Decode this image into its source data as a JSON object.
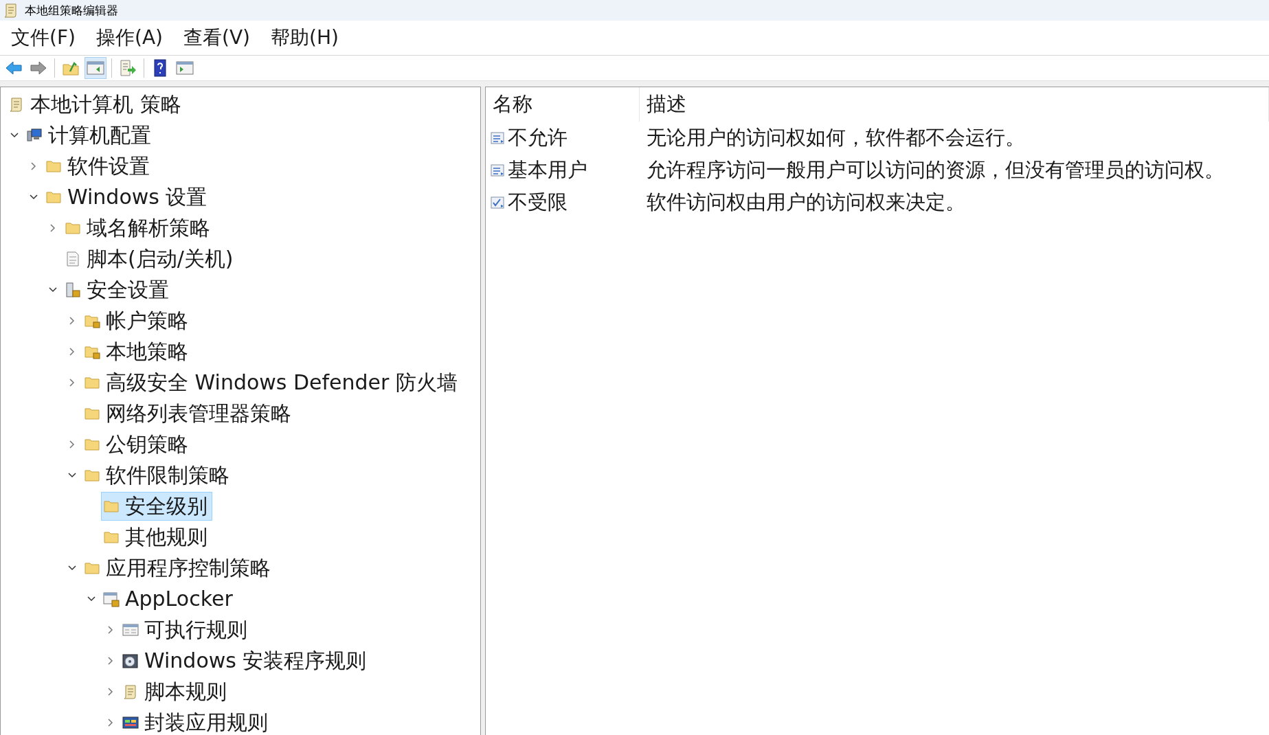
{
  "window": {
    "title": "本地组策略编辑器"
  },
  "menu": [
    "文件(F)",
    "操作(A)",
    "查看(V)",
    "帮助(H)"
  ],
  "toolbar": [
    [
      {
        "kind": "back",
        "pressed": false
      },
      {
        "kind": "forward",
        "pressed": false
      }
    ],
    [
      {
        "kind": "up",
        "pressed": false
      },
      {
        "kind": "tree-toggle",
        "pressed": true
      }
    ],
    [
      {
        "kind": "export",
        "pressed": false
      }
    ],
    [
      {
        "kind": "help",
        "pressed": false
      },
      {
        "kind": "action-pane",
        "pressed": false
      }
    ]
  ],
  "tree": {
    "label": "本地计算机 策略",
    "kind": "scroll",
    "selected": false,
    "children": [
      {
        "label": "计算机配置",
        "kind": "computer",
        "expanded": true,
        "selected": false,
        "children": [
          {
            "label": "软件设置",
            "kind": "folder",
            "expanded": false,
            "selected": false
          },
          {
            "label": "Windows 设置",
            "kind": "folder",
            "expanded": true,
            "selected": false,
            "children": [
              {
                "label": "域名解析策略",
                "kind": "folder",
                "expanded": false,
                "selected": false
              },
              {
                "label": "脚本(启动/关机)",
                "kind": "script",
                "selected": false
              },
              {
                "label": "安全设置",
                "kind": "security",
                "expanded": true,
                "selected": false,
                "children": [
                  {
                    "label": "帐户策略",
                    "kind": "folder-lock",
                    "expanded": false,
                    "selected": false
                  },
                  {
                    "label": "本地策略",
                    "kind": "folder-lock",
                    "expanded": false,
                    "selected": false
                  },
                  {
                    "label": "高级安全 Windows Defender 防火墙",
                    "kind": "folder",
                    "expanded": false,
                    "selected": false
                  },
                  {
                    "label": "网络列表管理器策略",
                    "kind": "folder",
                    "selected": false
                  },
                  {
                    "label": "公钥策略",
                    "kind": "folder",
                    "expanded": false,
                    "selected": false
                  },
                  {
                    "label": "软件限制策略",
                    "kind": "folder",
                    "expanded": true,
                    "selected": false,
                    "children": [
                      {
                        "label": "安全级别",
                        "kind": "folder",
                        "selected": true
                      },
                      {
                        "label": "其他规则",
                        "kind": "folder",
                        "selected": false
                      }
                    ]
                  },
                  {
                    "label": "应用程序控制策略",
                    "kind": "folder",
                    "expanded": true,
                    "selected": false,
                    "children": [
                      {
                        "label": "AppLocker",
                        "kind": "window-lock",
                        "expanded": true,
                        "selected": false,
                        "children": [
                          {
                            "label": "可执行规则",
                            "kind": "window",
                            "expanded": false,
                            "selected": false
                          },
                          {
                            "label": "Windows 安装程序规则",
                            "kind": "installer",
                            "expanded": false,
                            "selected": false
                          },
                          {
                            "label": "脚本规则",
                            "kind": "scroll",
                            "expanded": false,
                            "selected": false
                          },
                          {
                            "label": "封装应用规则",
                            "kind": "package",
                            "expanded": false,
                            "selected": false
                          }
                        ]
                      }
                    ]
                  }
                ]
              }
            ]
          }
        ]
      }
    ]
  },
  "list": {
    "columns": [
      "名称",
      "描述"
    ],
    "rows": [
      {
        "name": "不允许",
        "description": "无论用户的访问权如何，软件都不会运行。",
        "kind": "level"
      },
      {
        "name": "基本用户",
        "description": "允许程序访问一般用户可以访问的资源，但没有管理员的访问权。",
        "kind": "level"
      },
      {
        "name": "不受限",
        "description": "软件访问权由用户的访问权来决定。",
        "kind": "level-default"
      }
    ]
  }
}
